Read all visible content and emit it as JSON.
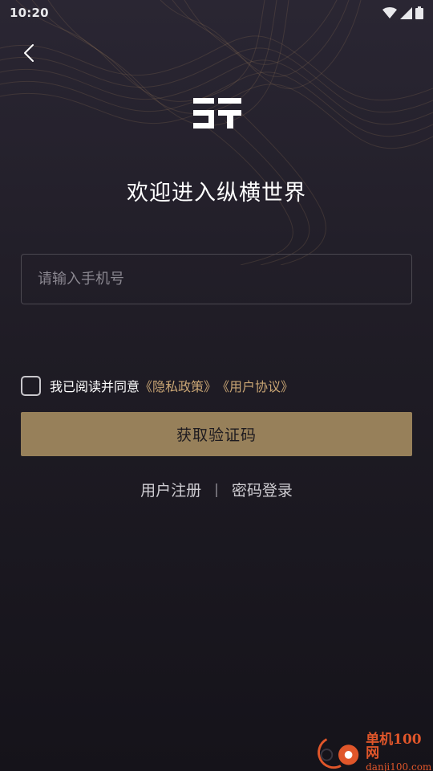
{
  "status_bar": {
    "time": "10:20",
    "icons": [
      "wifi-icon",
      "cell-signal-icon",
      "battery-icon"
    ]
  },
  "header": {
    "back_icon": "chevron-left-icon",
    "logo_text": "ST"
  },
  "welcome": {
    "title": "欢迎进入纵横世界"
  },
  "phone": {
    "value": "",
    "placeholder": "请输入手机号"
  },
  "agreement": {
    "checked": false,
    "prefix": "我已阅读并同意",
    "privacy_link": "《隐私政策》",
    "terms_link": "《用户协议》"
  },
  "primary_button": {
    "label": "获取验证码"
  },
  "bottom_links": {
    "register": "用户注册",
    "divider": "|",
    "password_login": "密码登录"
  },
  "watermark": {
    "title": "单机100网",
    "url": "danji100.com"
  },
  "colors": {
    "accent_gold": "#c9a574",
    "button_gold": "#97805a",
    "background_top": "#2a2633",
    "background_bottom": "#15131a",
    "watermark_orange": "#e0562a"
  }
}
